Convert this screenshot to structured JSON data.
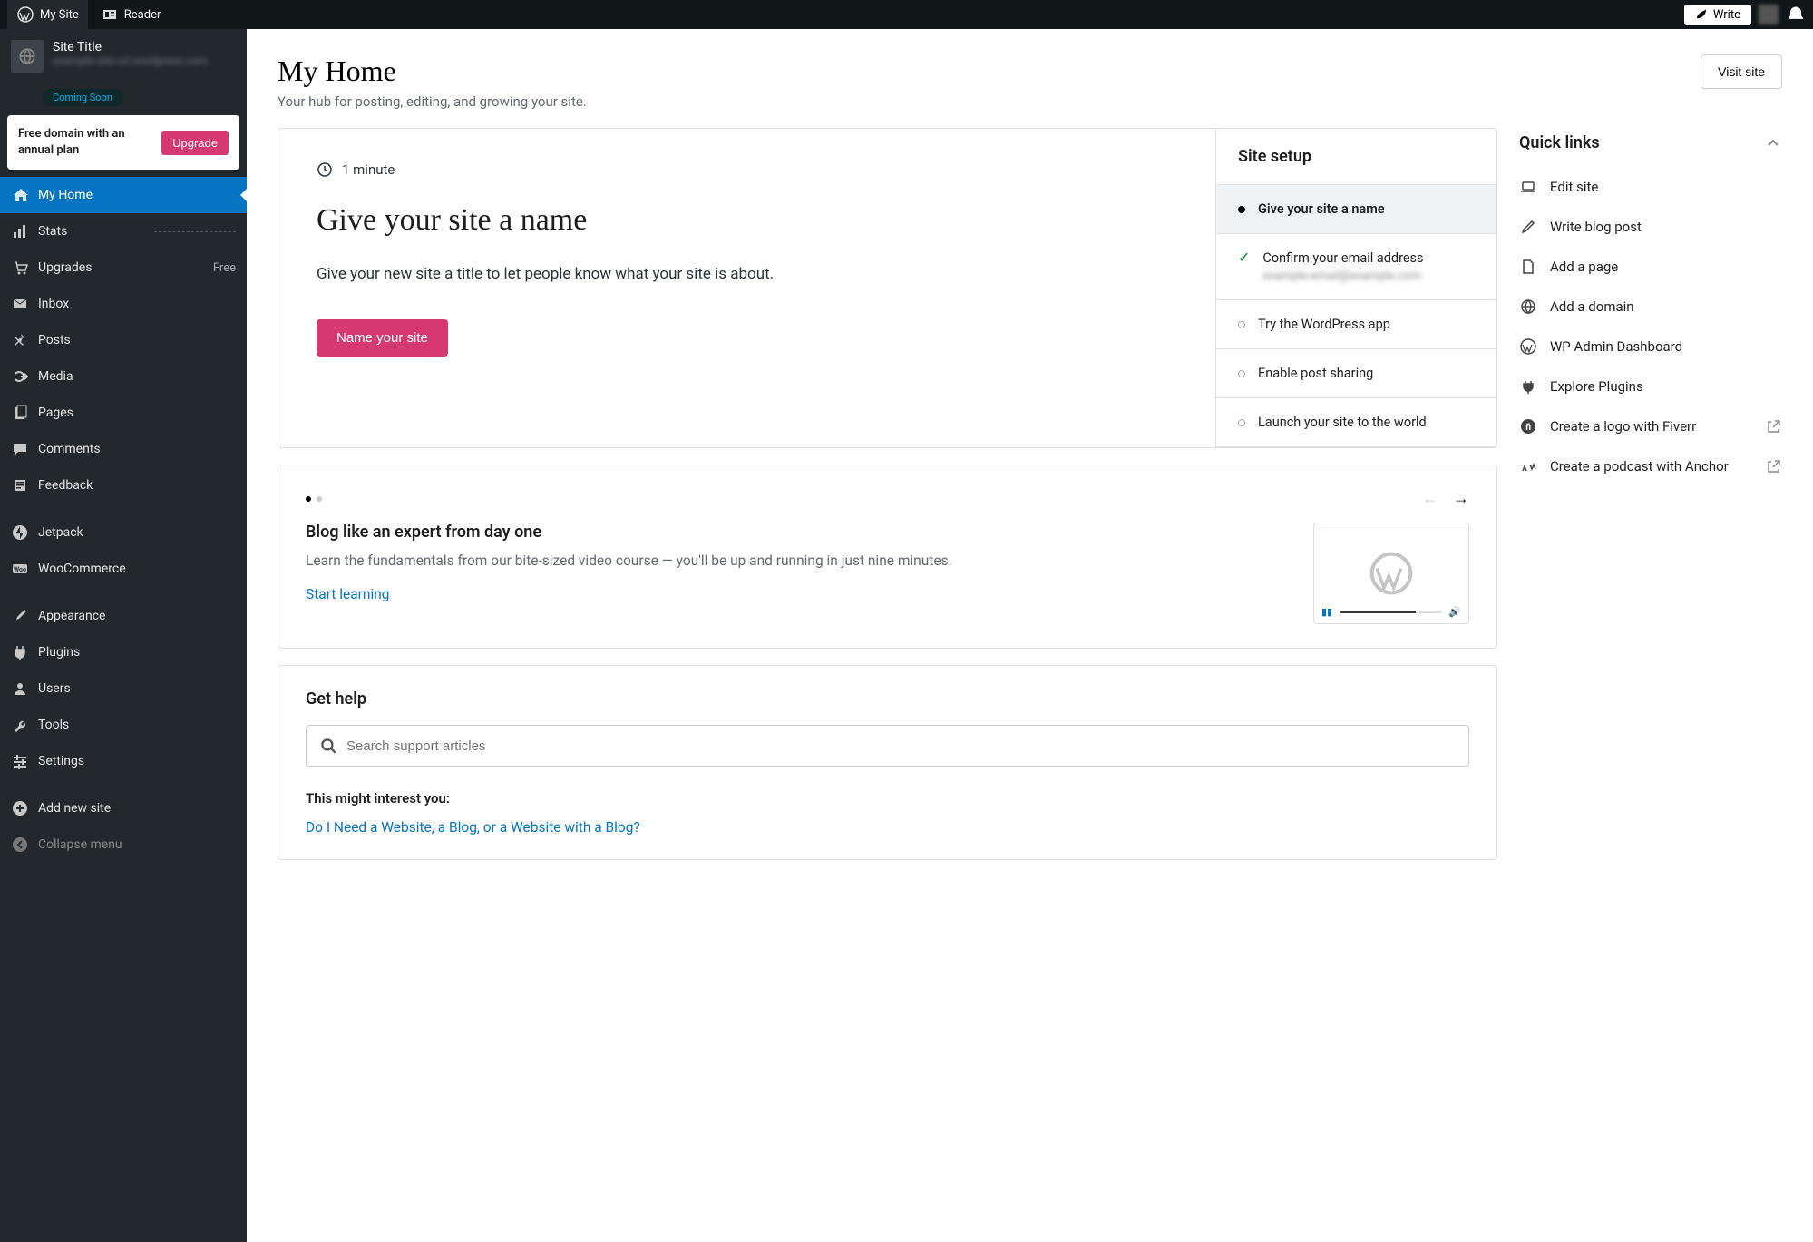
{
  "topbar": {
    "mysite": "My Site",
    "reader": "Reader",
    "write": "Write"
  },
  "site": {
    "title": "Site Title",
    "url": "example-site-url.wordpress.com",
    "badge": "Coming Soon"
  },
  "upgrade": {
    "text": "Free domain with an annual plan",
    "button": "Upgrade"
  },
  "menu": [
    {
      "id": "home",
      "label": "My Home",
      "icon": "home",
      "active": true
    },
    {
      "id": "stats",
      "label": "Stats",
      "icon": "stats",
      "stats_line": true
    },
    {
      "id": "upgrades",
      "label": "Upgrades",
      "icon": "cart",
      "badge": "Free"
    },
    {
      "id": "inbox",
      "label": "Inbox",
      "icon": "mail"
    },
    {
      "id": "posts",
      "label": "Posts",
      "icon": "pin"
    },
    {
      "id": "media",
      "label": "Media",
      "icon": "media"
    },
    {
      "id": "pages",
      "label": "Pages",
      "icon": "pages"
    },
    {
      "id": "comments",
      "label": "Comments",
      "icon": "comment"
    },
    {
      "id": "feedback",
      "label": "Feedback",
      "icon": "form"
    },
    {
      "id": "sep1",
      "sep": true
    },
    {
      "id": "jetpack",
      "label": "Jetpack",
      "icon": "jetpack"
    },
    {
      "id": "woo",
      "label": "WooCommerce",
      "icon": "woo"
    },
    {
      "id": "sep2",
      "sep": true
    },
    {
      "id": "appearance",
      "label": "Appearance",
      "icon": "brush"
    },
    {
      "id": "plugins",
      "label": "Plugins",
      "icon": "plug"
    },
    {
      "id": "users",
      "label": "Users",
      "icon": "user"
    },
    {
      "id": "tools",
      "label": "Tools",
      "icon": "wrench"
    },
    {
      "id": "settings",
      "label": "Settings",
      "icon": "sliders"
    },
    {
      "id": "sep3",
      "sep": true
    },
    {
      "id": "addsite",
      "label": "Add new site",
      "icon": "plus"
    },
    {
      "id": "collapse",
      "label": "Collapse menu",
      "icon": "collapse",
      "muted": true
    }
  ],
  "page": {
    "title": "My Home",
    "subtitle": "Your hub for posting, editing, and growing your site.",
    "visit": "Visit site"
  },
  "task": {
    "duration": "1 minute",
    "title": "Give your site a name",
    "desc": "Give your new site a title to let people know what your site is about.",
    "button": "Name your site"
  },
  "setup": {
    "heading": "Site setup",
    "items": [
      {
        "label": "Give your site a name",
        "state": "current"
      },
      {
        "label": "Confirm your email address",
        "sub": "example-email@example.com",
        "state": "done"
      },
      {
        "label": "Try the WordPress app",
        "state": "todo"
      },
      {
        "label": "Enable post sharing",
        "state": "todo"
      },
      {
        "label": "Launch your site to the world",
        "state": "todo"
      }
    ]
  },
  "carousel": {
    "title": "Blog like an expert from day one",
    "desc": "Learn the fundamentals from our bite-sized video course — you'll be up and running in just nine minutes.",
    "link": "Start learning"
  },
  "help": {
    "heading": "Get help",
    "placeholder": "Search support articles",
    "interest_head": "This might interest you:",
    "interest_link": "Do I Need a Website, a Blog, or a Website with a Blog?"
  },
  "quicklinks": {
    "heading": "Quick links",
    "items": [
      {
        "label": "Edit site",
        "icon": "laptop"
      },
      {
        "label": "Write blog post",
        "icon": "pencil"
      },
      {
        "label": "Add a page",
        "icon": "file"
      },
      {
        "label": "Add a domain",
        "icon": "globe"
      },
      {
        "label": "WP Admin Dashboard",
        "icon": "wp"
      },
      {
        "label": "Explore Plugins",
        "icon": "plugsolid"
      },
      {
        "label": "Create a logo with Fiverr",
        "icon": "fiverr",
        "external": true
      },
      {
        "label": "Create a podcast with Anchor",
        "icon": "anchor",
        "external": true
      }
    ]
  },
  "icons": {
    "home": "<path d='M10 2 L2 9 h2 v7 h4 v-5 h4 v5 h4 v-7 h2 Z' fill='currentColor'/>",
    "stats": "<rect x='2' y='10' width='3' height='6' fill='currentColor'/><rect x='7' y='6' width='3' height='10' fill='currentColor'/><rect x='12' y='2' width='3' height='14' fill='currentColor'/>",
    "cart": "<path d='M3 3h2l2 9h8l2-6H6' stroke='currentColor' fill='none' stroke-width='1.5'/><circle cx='8' cy='15' r='1.5' fill='currentColor'/><circle cx='14' cy='15' r='1.5' fill='currentColor'/>",
    "mail": "<rect x='2' y='4' width='14' height='10' fill='currentColor'/><path d='M2 4 l7 5 l7 -5' stroke='#23282d' fill='none'/>",
    "pin": "<path d='M10 2 l4 4 l-1 1 l-1 -1 l-2 5 l3 3 l-1 1 l-4 -4 l-4 4 l-1 -1 l4 -4 l-4 -4 l1 -1 l3 3 l5 -2 l-1 -1 Z' fill='currentColor'/>",
    "media": "<path d='M4 6a5 5 0 1 1 0 6' stroke='currentColor' fill='none' stroke-width='2'/><rect x='10' y='8' width='7' height='2' fill='currentColor'/><path d='M14 6 l3 3 l-3 3' stroke='currentColor' fill='none' stroke-width='2'/>",
    "pages": "<rect x='3' y='3' width='10' height='13' fill='currentColor'/><rect x='6' y='1' width='10' height='13' fill='#23282d' stroke='currentColor'/>",
    "comment": "<path d='M2 3 h14 v9 h-9 l-3 3 v-3 h-2 Z' fill='currentColor'/>",
    "form": "<rect x='3' y='3' width='12' height='12' fill='currentColor'/><rect x='5' y='5' width='8' height='1.5' fill='#23282d'/><rect x='5' y='8' width='8' height='1.5' fill='#23282d'/><rect x='5' y='11' width='5' height='1.5' fill='#23282d'/>",
    "jetpack": "<circle cx='9' cy='9' r='8' fill='currentColor'/><path d='M9 2 v7 h-4 Z M9 16 v-7 h4 Z' fill='#23282d'/>",
    "woo": "<rect x='1' y='4' width='16' height='10' rx='2' fill='currentColor'/><text x='9' y='12' text-anchor='middle' font-size='7' fill='#23282d' font-weight='bold'>Woo</text>",
    "brush": "<path d='M14 2 l2 2 l-8 8 l-3 1 l1 -3 Z' fill='currentColor'/>",
    "plug": "<path d='M6 2 v4 M12 2 v4 M4 6 h10 v4 a5 5 0 0 1 -10 0 Z M9 15 v3' stroke='currentColor' fill='currentColor' stroke-width='1.5'/>",
    "user": "<circle cx='9' cy='6' r='3' fill='currentColor'/><path d='M3 16 a6 5 0 0 1 12 0 Z' fill='currentColor'/>",
    "wrench": "<path d='M13 5 a4 4 0 0 0 -5 5 l-5 5 l2 2 l5 -5 a4 4 0 0 0 5 -5 l-3 3 l-2 -2 Z' fill='currentColor'/>",
    "sliders": "<rect x='2' y='4' width='14' height='2' fill='currentColor'/><rect x='2' y='9' width='14' height='2' fill='currentColor'/><rect x='2' y='14' width='14' height='2' fill='currentColor'/><rect x='5' y='2' width='2' height='6' fill='currentColor'/><rect x='11' y='7' width='2' height='6' fill='currentColor'/><rect x='7' y='12' width='2' height='6' fill='currentColor'/>",
    "plus": "<circle cx='9' cy='9' r='8' fill='currentColor'/><path d='M9 5 v8 M5 9 h8' stroke='#23282d' stroke-width='2'/>",
    "collapse": "<circle cx='9' cy='9' r='8' fill='currentColor'/><path d='M11 5 l-4 4 l4 4' stroke='#23282d' fill='none' stroke-width='2'/>",
    "laptop": "<rect x='3' y='4' width='12' height='8' rx='1' stroke='currentColor' fill='none' stroke-width='1.5'/><path d='M1 14 h16' stroke='currentColor' stroke-width='1.5'/>",
    "pencil": "<path d='M13 3 l2 2 l-9 9 l-3 1 l1 -3 Z' fill='none' stroke='currentColor' stroke-width='1.5'/>",
    "file": "<path d='M4 2 h7 l3 3 v11 h-10 Z' stroke='currentColor' fill='none' stroke-width='1.5'/>",
    "globe": "<circle cx='9' cy='9' r='7' stroke='currentColor' fill='none' stroke-width='1.5'/><path d='M2 9 h14 M9 2 a10 10 0 0 1 0 14 a10 10 0 0 1 0 -14' stroke='currentColor' fill='none' stroke-width='1.5'/>",
    "wp": "<circle cx='9' cy='9' r='8' stroke='currentColor' fill='none' stroke-width='1.5'/><path d='M3 7 l3 8 l2 -5 l2 5 l3 -8' stroke='currentColor' fill='none' stroke-width='1.3'/>",
    "plugsolid": "<path d='M6 3 v3 M12 3 v3 M4 6 h10 v3 a5 5 0 0 1 -10 0 Z M9 14 v3' fill='currentColor' stroke='currentColor' stroke-width='1.5'/>",
    "fiverr": "<circle cx='9' cy='9' r='8' fill='currentColor'/><text x='9' y='13' text-anchor='middle' font-size='10' fill='#fff' font-weight='bold'>fi</text>",
    "anchor": "<path d='M3 14 l2 -5 l2 5 M5 11 v-4 M11 7 l2 5 l2 -5 l2 5' stroke='currentColor' fill='none' stroke-width='1.5'/>",
    "external": "<path d='M6 4 h-3 v11 h11 v-3 M10 3 h5 v5 M15 3 l-7 7' stroke='currentColor' fill='none' stroke-width='1.5'/>",
    "clock": "<circle cx='9' cy='9' r='7' stroke='currentColor' fill='none' stroke-width='1.5'/><path d='M9 5 v4 l3 2' stroke='currentColor' fill='none' stroke-width='1.5'/>",
    "leaf": "<path d='M3 14 C 4 6, 14 4, 15 3 C 14 12, 6 14, 3 14 M3 14 l5 -5' stroke='currentColor' fill='currentColor' stroke-width='1'/>",
    "reader": "<rect x='2' y='4' width='14' height='10' fill='currentColor'/><rect x='4' y='6' width='4' height='6' fill='#101517'/><rect x='10' y='6' width='4' height='1.5' fill='#101517'/><rect x='10' y='9' width='4' height='1.5' fill='#101517'/>",
    "bell": "<path d='M9 2 a5 5 0 0 1 5 5 v3 l2 3 h-14 l2 -3 v-3 a5 5 0 0 1 5 -5 Z' fill='currentColor'/>",
    "chevron-up": "<path d='M5 12 l5 -5 l5 5' stroke='currentColor' fill='none' stroke-width='2'/>"
  }
}
